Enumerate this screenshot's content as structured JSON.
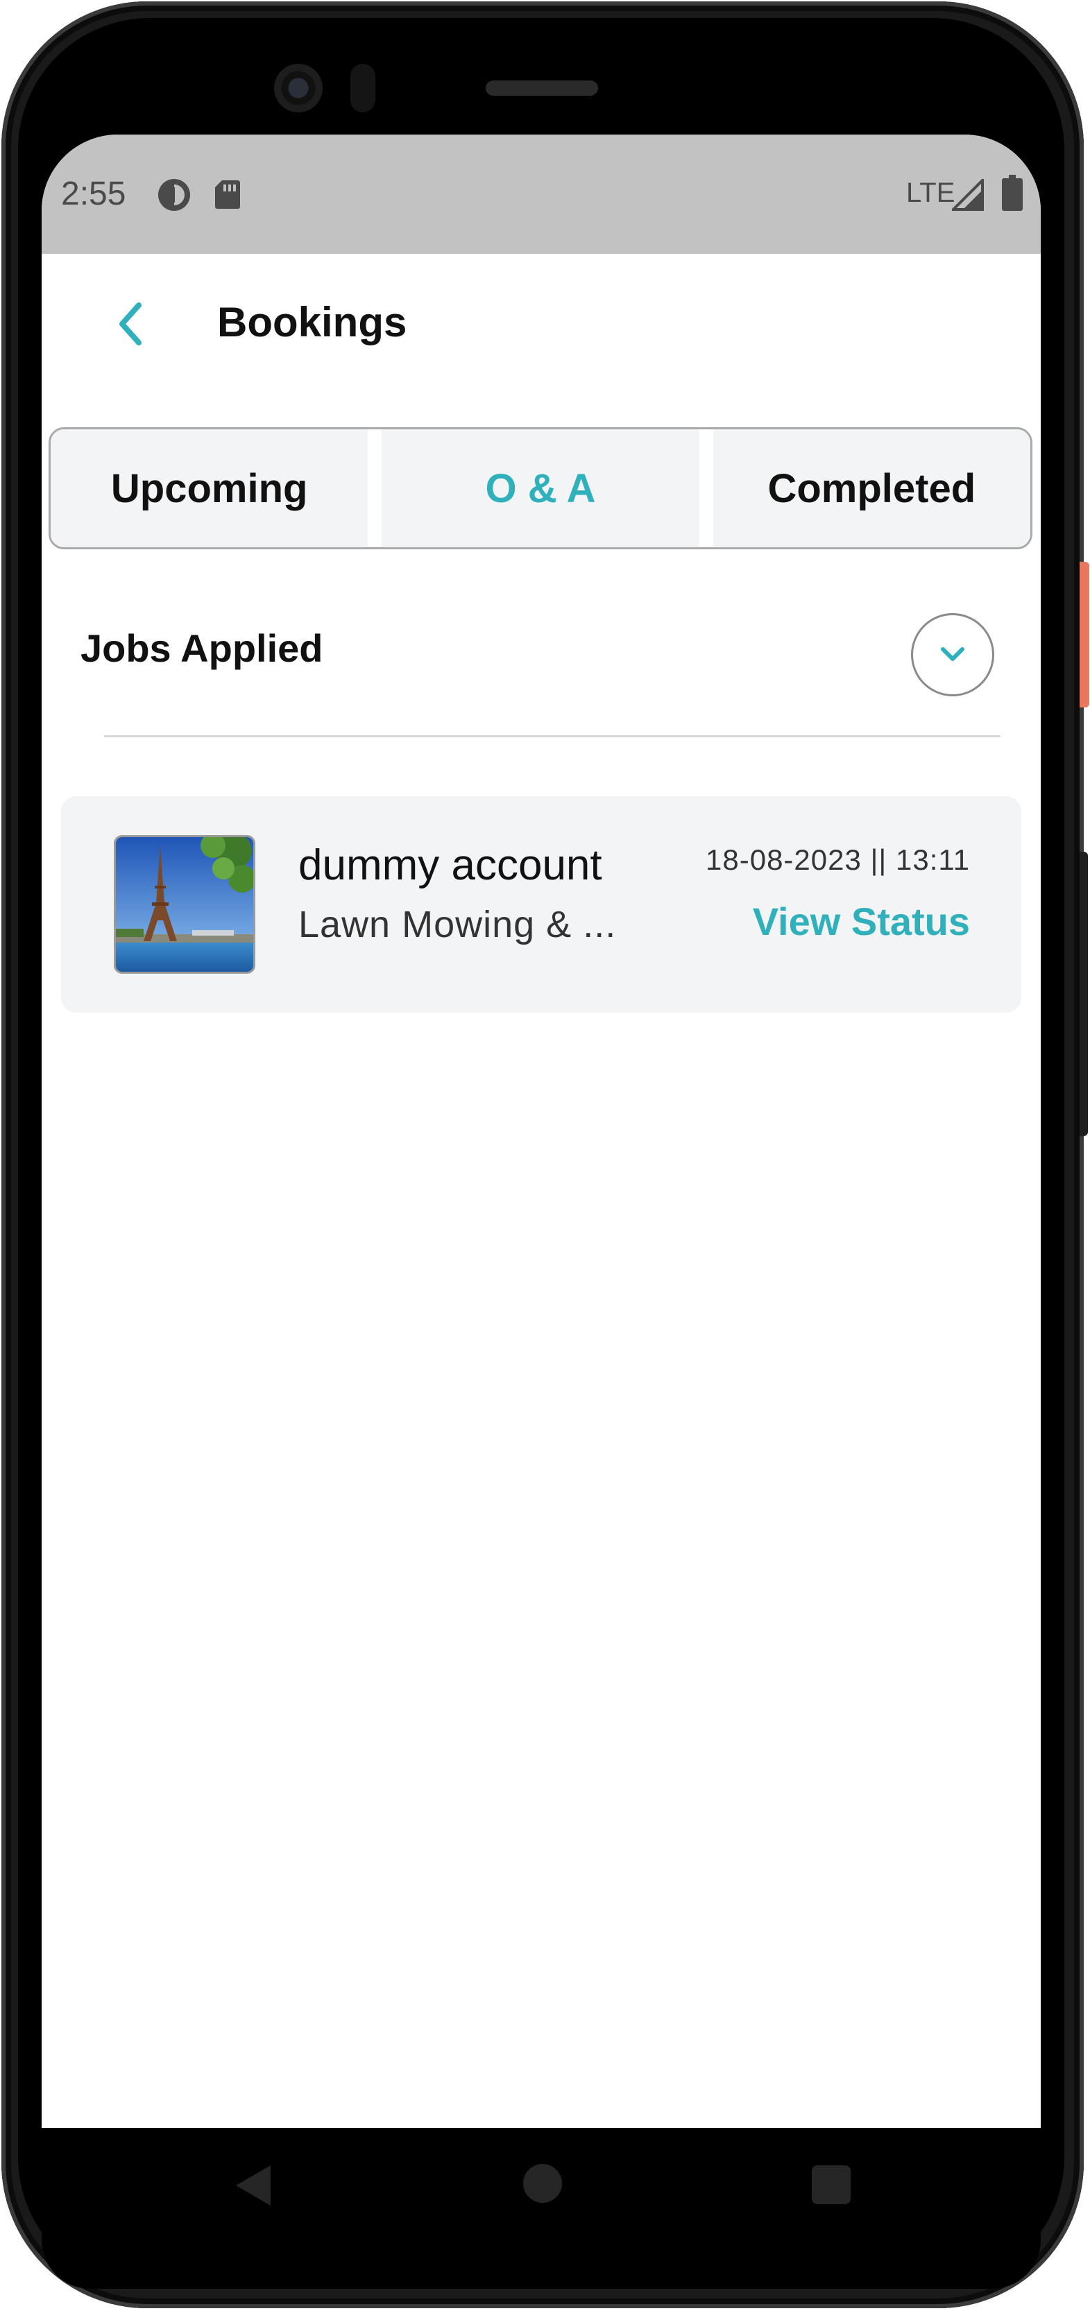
{
  "status_bar": {
    "time": "2:55",
    "network": "LTE",
    "icons": [
      "data-saver-icon",
      "sd-card-icon",
      "signal-icon",
      "battery-icon"
    ]
  },
  "header": {
    "title": "Bookings",
    "back_icon": "chevron-left-icon"
  },
  "tabs": [
    {
      "label": "Upcoming",
      "active": false
    },
    {
      "label": "O & A",
      "active": true
    },
    {
      "label": "Completed",
      "active": false
    }
  ],
  "section": {
    "title": "Jobs Applied",
    "toggle_icon": "chevron-down-icon"
  },
  "bookings": [
    {
      "name": "dummy account",
      "service": "Lawn Mowing & ...",
      "datetime": "18-08-2023 || 13:11",
      "action": "View Status",
      "thumbnail": "eiffel-tower-photo"
    }
  ],
  "nav_bar": {
    "icons": [
      "back-triangle-icon",
      "home-circle-icon",
      "recents-square-icon"
    ]
  },
  "colors": {
    "accent": "#2fb0ba",
    "status_bar": "#c2c2c2",
    "card_bg": "#f3f4f6"
  }
}
